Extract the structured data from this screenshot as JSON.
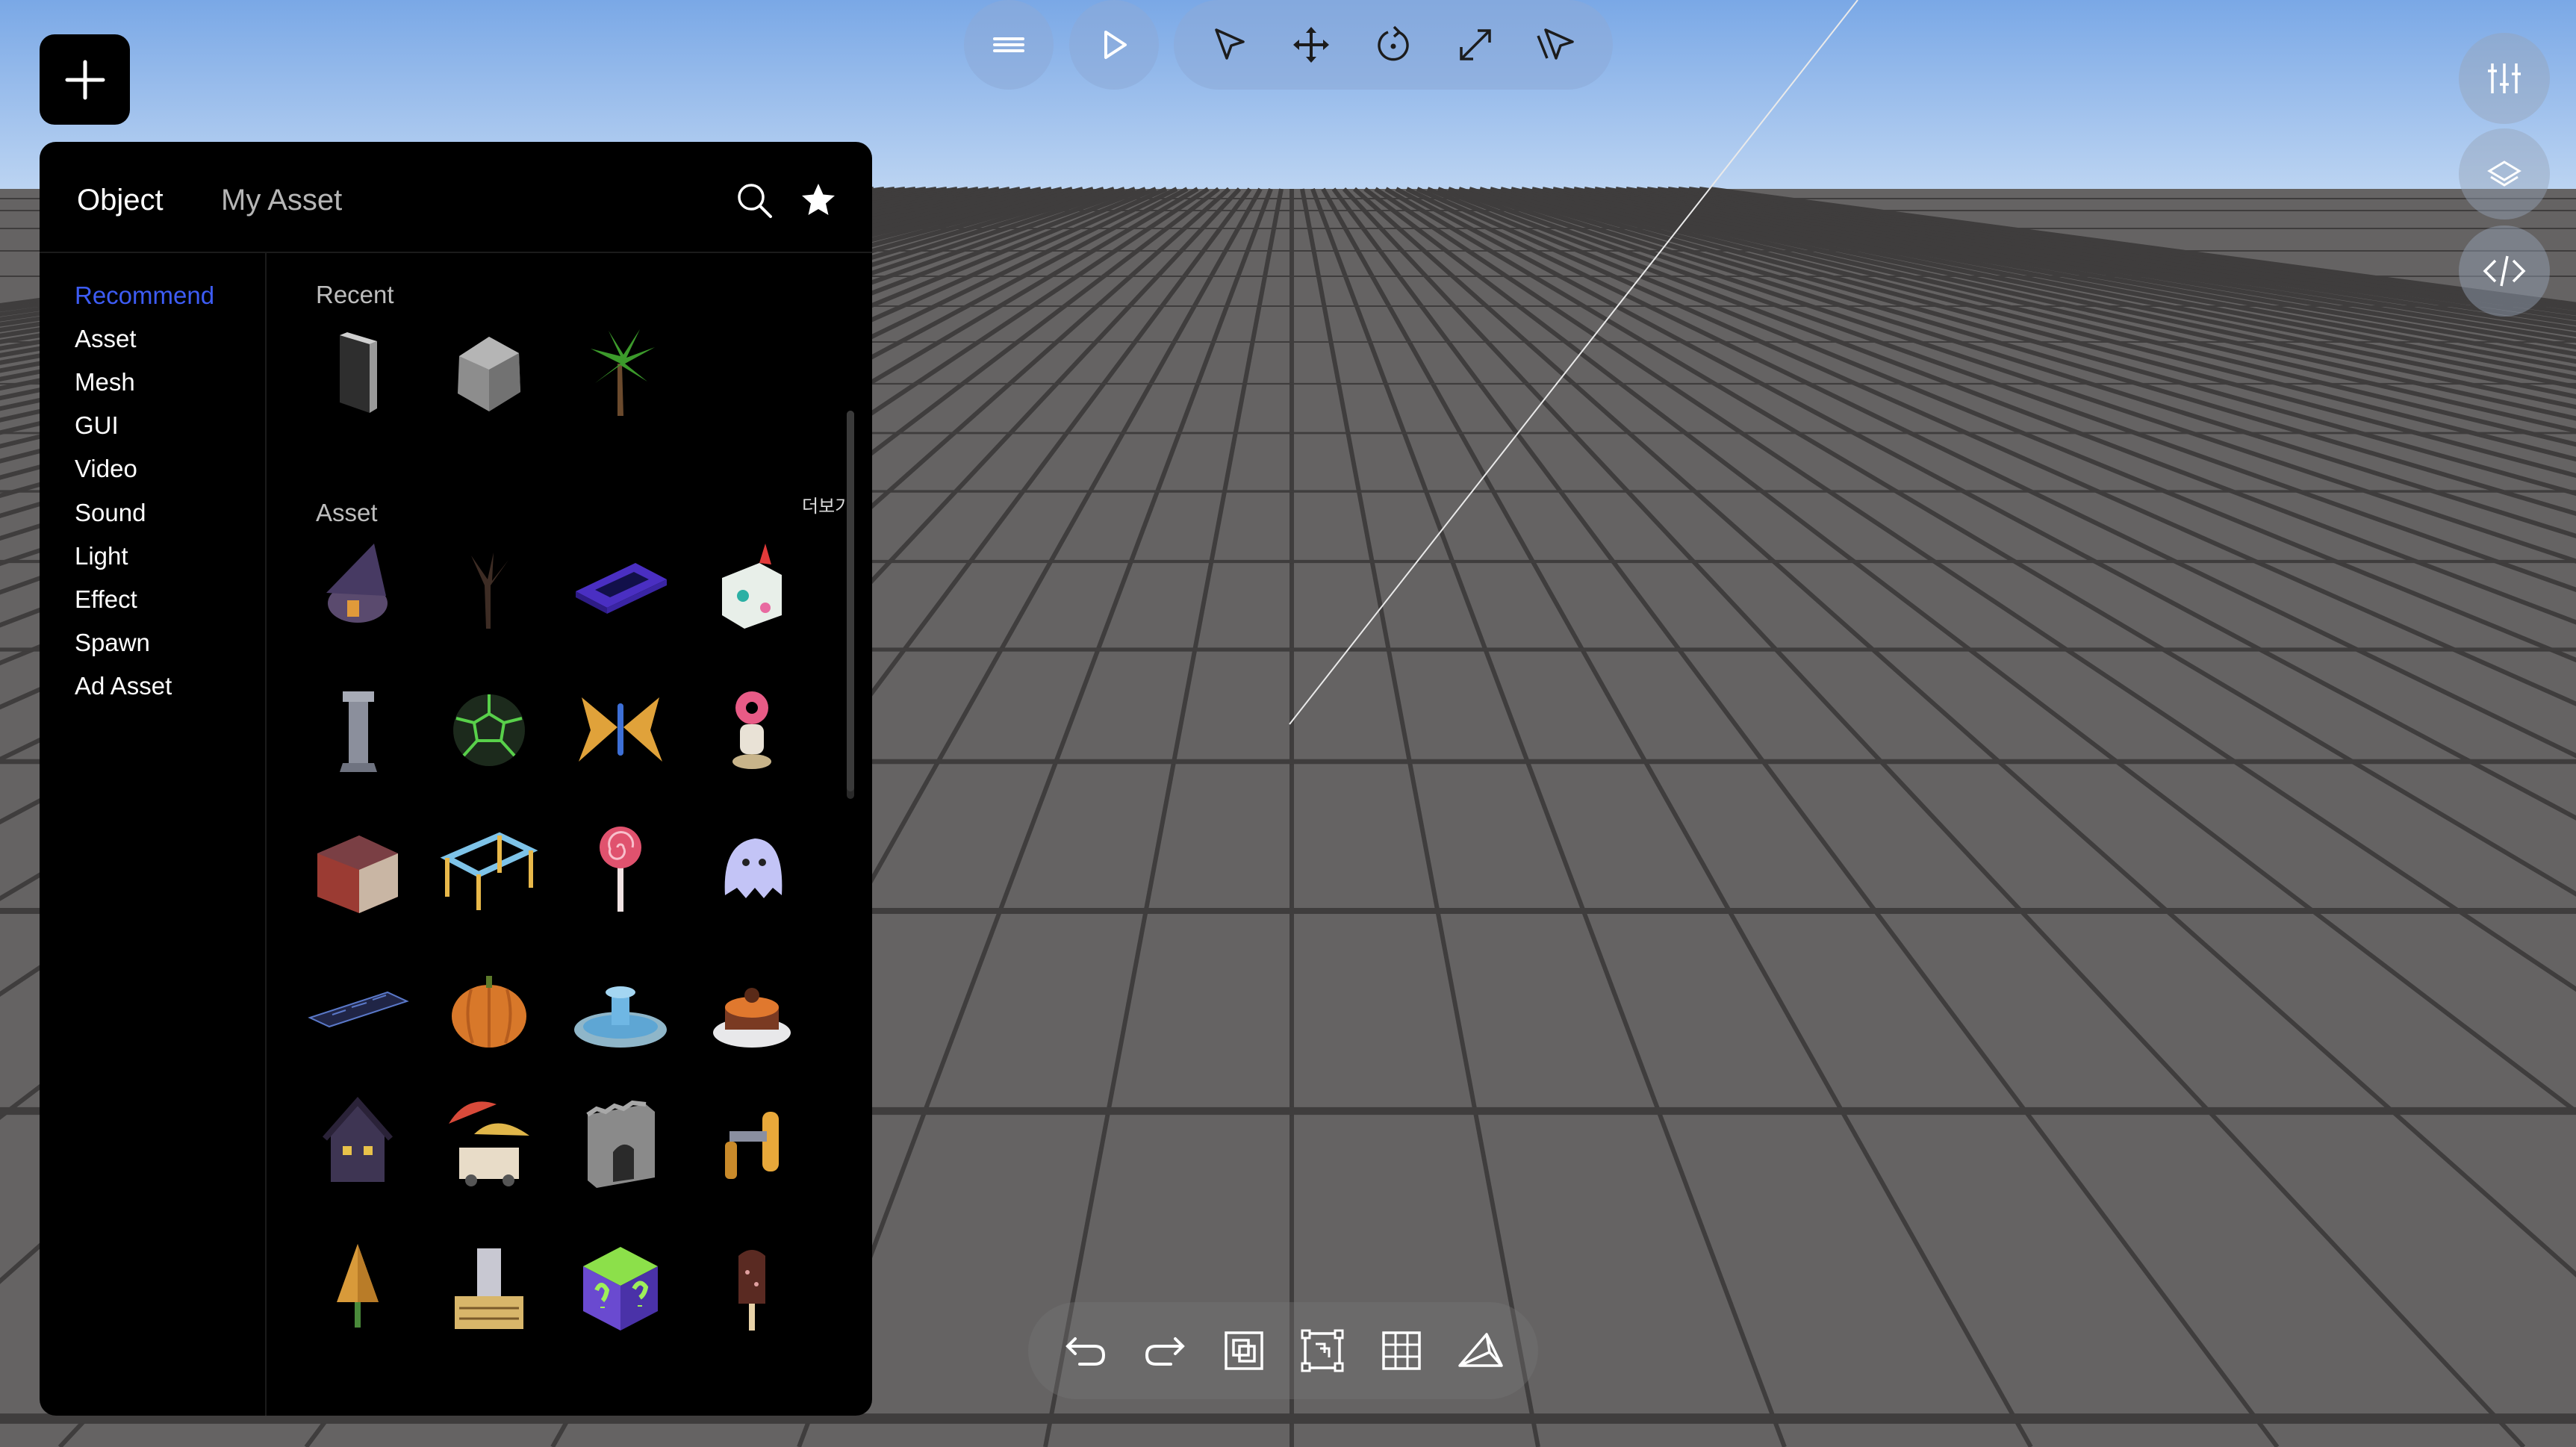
{
  "colors": {
    "accent": "#3d5cf5",
    "panel_bg": "#000000",
    "sky_top": "#7aa8e6",
    "sky_bottom": "#b9d3f3",
    "floor": "#626060"
  },
  "top_toolbar": {
    "menu_icon": "menu-icon",
    "play_icon": "play-icon",
    "tools": [
      "select-arrow-icon",
      "move-arrows-icon",
      "rotate-icon",
      "scale-expand-icon",
      "multi-select-icon"
    ]
  },
  "right_toolbar": [
    "sliders-settings-icon",
    "layers-icon",
    "code-icon"
  ],
  "panel": {
    "tabs": [
      "Object",
      "My Asset"
    ],
    "categories": [
      "Recommend",
      "Asset",
      "Mesh",
      "GUI",
      "Video",
      "Sound",
      "Light",
      "Effect",
      "Spawn",
      "Ad Asset"
    ],
    "active_category": "Recommend",
    "recent_title": "Recent",
    "recent_items": [
      "dark-panel-block",
      "gray-rock",
      "palm-tree"
    ],
    "asset_title": "Asset",
    "asset_more": "더보기",
    "asset_items": [
      "witch-hat-house",
      "dead-tree",
      "neon-platform",
      "toy-unicorn",
      "stone-tower",
      "green-hex-ball",
      "butterfly",
      "donut-character",
      "brick-house",
      "playground-frame",
      "lollipop",
      "ghost",
      "dark-tiles",
      "pumpkin",
      "fountain",
      "cake",
      "haunted-house",
      "umbrella-stall",
      "castle-gate",
      "pipe-part",
      "orange-tree",
      "city-building",
      "question-cube",
      "popsicle"
    ]
  },
  "bottom_toolbar": [
    "undo-icon",
    "redo-icon",
    "duplicate-icon",
    "group-icon",
    "grid-icon",
    "camera-icon"
  ]
}
